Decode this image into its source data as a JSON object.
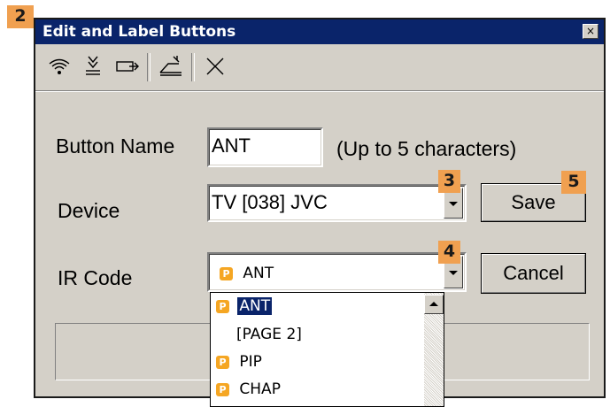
{
  "callouts": {
    "c2": "2",
    "c3": "3",
    "c4": "4",
    "c5": "5"
  },
  "window": {
    "title": "Edit and Label Buttons",
    "close_glyph": "×"
  },
  "toolbar": {
    "icons": [
      "wireless-learn-icon",
      "download-icon",
      "redirect-icon",
      "edit-note-icon",
      "delete-icon"
    ]
  },
  "form": {
    "button_name_label": "Button Name",
    "button_name_value": "ANT",
    "button_name_hint": "(Up to 5 characters)",
    "device_label": "Device",
    "device_value": "TV [038] JVC",
    "ir_code_label": "IR Code",
    "ir_code_value": "ANT",
    "ir_code_badge": "P"
  },
  "buttons": {
    "save": "Save",
    "cancel": "Cancel"
  },
  "ir_code_list": {
    "items": [
      {
        "badge": "P",
        "label": "ANT",
        "selected": true
      },
      {
        "badge": "",
        "label": "[PAGE 2]",
        "selected": false
      },
      {
        "badge": "P",
        "label": "PIP",
        "selected": false
      },
      {
        "badge": "P",
        "label": "CHAP",
        "selected": false
      }
    ]
  },
  "colors": {
    "titlebar": "#0a246a",
    "callout": "#f0a050",
    "badge": "#f5a623",
    "dialog_face": "#d4d0c8"
  }
}
